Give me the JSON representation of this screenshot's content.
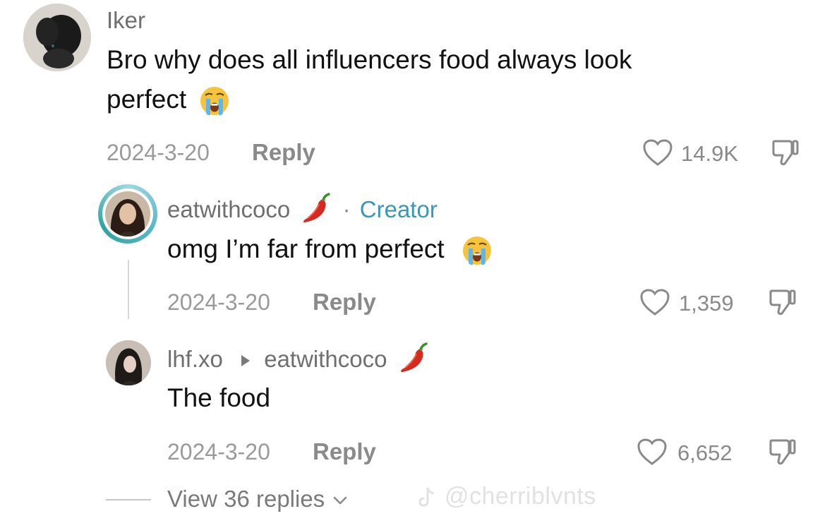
{
  "comment": {
    "username": "Iker",
    "text_line1": "Bro why does all influencers food always look",
    "text_line2": "perfect",
    "date": "2024-3-20",
    "reply_label": "Reply",
    "likes": "14.9K",
    "emoji_icon": "loudly-crying-face-icon"
  },
  "reply1": {
    "username": "eatwithcoco",
    "username_emoji": "hot-pepper-icon",
    "separator": "·",
    "creator_badge": "Creator",
    "text": "omg I’m far from perfect",
    "date": "2024-3-20",
    "reply_label": "Reply",
    "likes": "1,359"
  },
  "reply2": {
    "username": "lhf.xo",
    "reply_to": "eatwithcoco",
    "text": "The food",
    "date": "2024-3-20",
    "reply_label": "Reply",
    "likes": "6,652"
  },
  "view_replies": {
    "label": "View 36 replies"
  },
  "watermark": {
    "handle": "@cherriblvnts"
  },
  "colors": {
    "creator_accent": "#3b97b8",
    "muted_text": "#8a8a8a",
    "pepper_red": "#d42a1f"
  }
}
